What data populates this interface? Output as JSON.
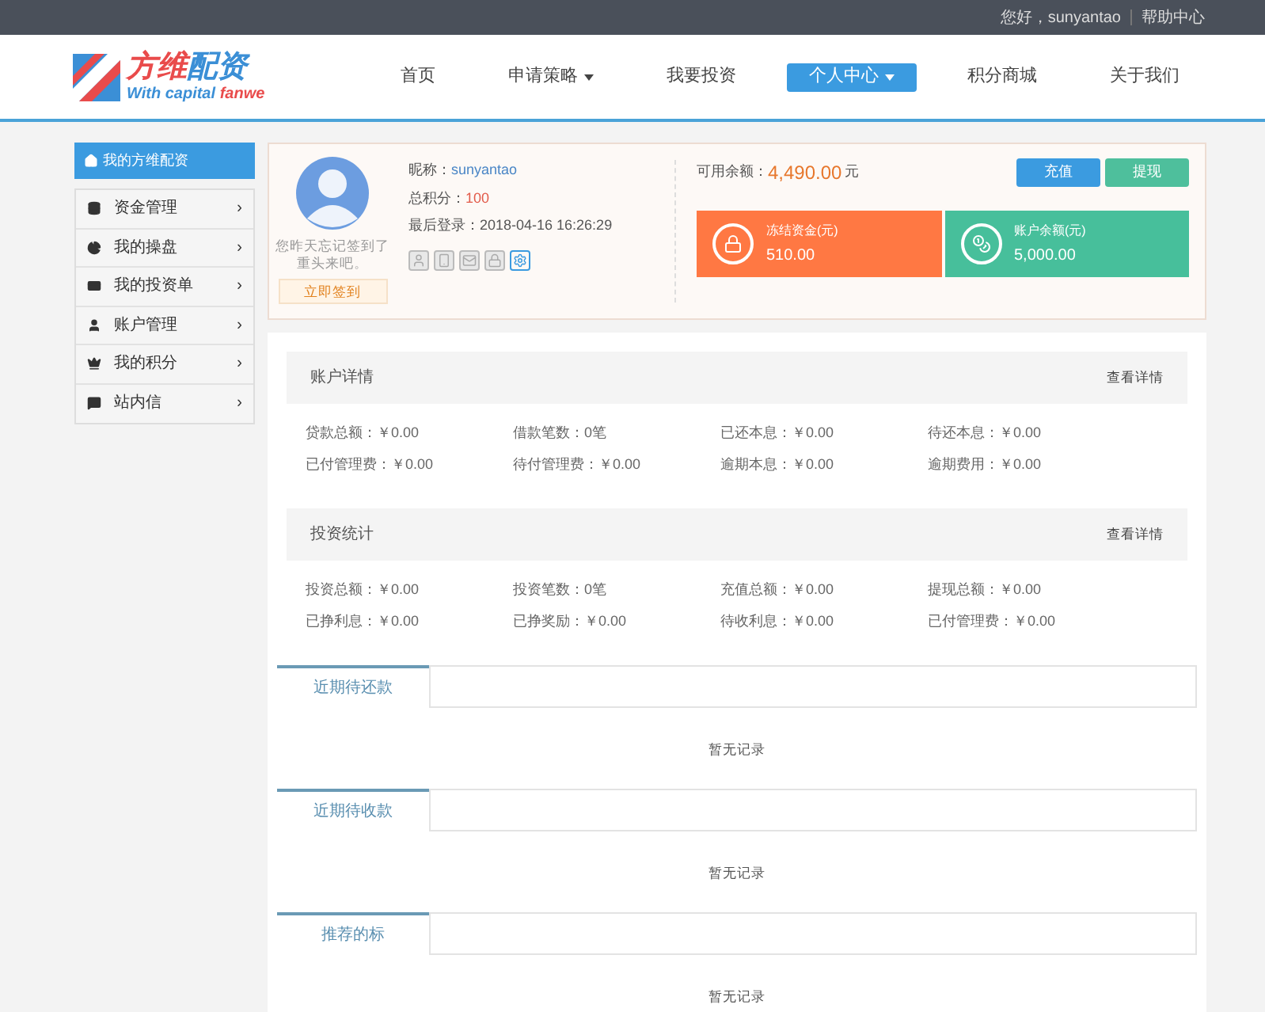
{
  "top_bar": {
    "greeting": "您好，sunyantao",
    "help": "帮助中心"
  },
  "logo": {
    "title_1": "方维",
    "title_2": "配资",
    "subtitle_1": "With capital",
    "subtitle_2": "fanwe"
  },
  "nav": [
    {
      "label": "首页",
      "selected": false,
      "dropdown": false
    },
    {
      "label": "申请策略",
      "selected": false,
      "dropdown": true
    },
    {
      "label": "我要投资",
      "selected": false,
      "dropdown": false
    },
    {
      "label": "个人中心",
      "selected": true,
      "dropdown": true
    },
    {
      "label": "积分商城",
      "selected": false,
      "dropdown": false
    },
    {
      "label": "关于我们",
      "selected": false,
      "dropdown": false
    }
  ],
  "sidebar": {
    "title": "我的方维配资",
    "items": [
      {
        "label": "资金管理",
        "arrow": "›"
      },
      {
        "label": "我的操盘",
        "arrow": "›"
      },
      {
        "label": "我的投资单",
        "arrow": "›"
      },
      {
        "label": "账户管理",
        "arrow": "›"
      },
      {
        "label": "我的积分",
        "arrow": "›"
      },
      {
        "label": "站内信",
        "arrow": "›"
      }
    ]
  },
  "profile": {
    "signin_note": "您昨天忘记签到了重头来吧。",
    "signin_button": "立即签到",
    "nickname_label": "昵称：",
    "nickname": "sunyantao",
    "points_label": "总积分：",
    "points": "100",
    "last_login": "最后登录：2018-04-16 16:26:29",
    "security": [
      {
        "on": false
      },
      {
        "on": false
      },
      {
        "on": false
      },
      {
        "on": false
      },
      {
        "on": true
      }
    ],
    "balance_label": "可用余额：",
    "balance": "4,490.00",
    "balance_unit": "元",
    "buttons": [
      "充值",
      "提现"
    ],
    "cards": [
      {
        "label": "冻结资金(元)",
        "value": "510.00",
        "color": "#ff7843"
      },
      {
        "label": "账户余额(元)",
        "value": "5,000.00",
        "color": "#47bf9b"
      }
    ]
  },
  "sections": [
    {
      "title": "账户详情",
      "link": "查看详情",
      "rows": [
        [
          "贷款总额：￥0.00",
          "借款笔数：0笔",
          "已还本息：￥0.00",
          "待还本息：￥0.00"
        ],
        [
          "已付管理费：￥0.00",
          "待付管理费：￥0.00",
          "逾期本息：￥0.00",
          "逾期费用：￥0.00"
        ]
      ]
    },
    {
      "title": "投资统计",
      "link": "查看详情",
      "rows": [
        [
          "投资总额：￥0.00",
          "投资笔数：0笔",
          "充值总额：￥0.00",
          "提现总额：￥0.00"
        ],
        [
          "已挣利息：￥0.00",
          "已挣奖励：￥0.00",
          "待收利息：￥0.00",
          "已付管理费：￥0.00"
        ]
      ]
    }
  ],
  "tab_panels": [
    {
      "tab": "近期待还款",
      "empty": "暂无记录"
    },
    {
      "tab": "近期待收款",
      "empty": "暂无记录"
    },
    {
      "tab": "推荐的标",
      "empty": "暂无记录"
    }
  ]
}
